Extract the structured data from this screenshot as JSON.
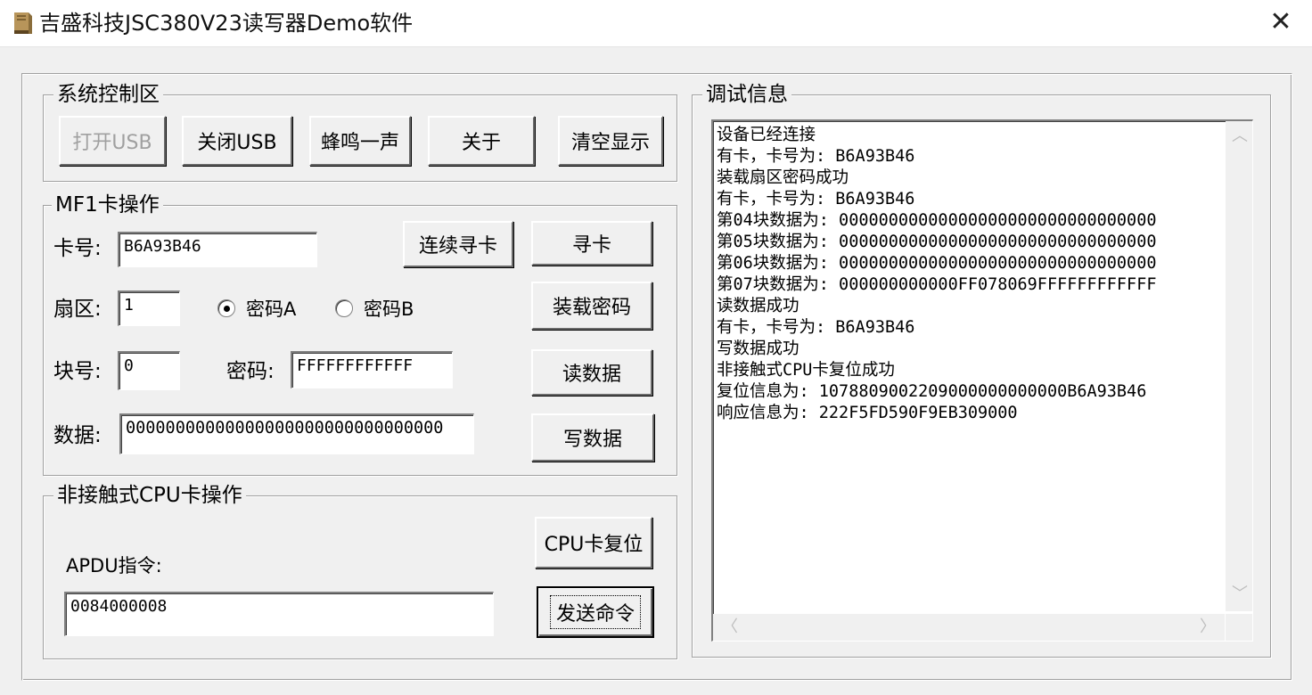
{
  "window": {
    "title": "吉盛科技JSC380V23读写器Demo软件",
    "close_glyph": "✕"
  },
  "system_group": {
    "title": "系统控制区",
    "open_usb": "打开USB",
    "close_usb": "关闭USB",
    "beep": "蜂鸣一声",
    "about": "关于",
    "clear": "清空显示"
  },
  "mf1_group": {
    "title": "MF1卡操作",
    "card_label": "卡号:",
    "card_value": "B6A93B46",
    "sector_label": "扇区:",
    "sector_value": "1",
    "key_a_label": "密码A",
    "key_b_label": "密码B",
    "selected_key": "A",
    "block_label": "块号:",
    "block_value": "0",
    "password_label": "密码:",
    "password_value": "FFFFFFFFFFFF",
    "data_label": "数据:",
    "data_value": "00000000000000000000000000000000",
    "continuous_search": "连续寻卡",
    "search": "寻卡",
    "load_key": "装载密码",
    "read_data": "读数据",
    "write_data": "写数据"
  },
  "cpu_group": {
    "title": "非接触式CPU卡操作",
    "apdu_label": "APDU指令:",
    "apdu_value": "0084000008",
    "reset": "CPU卡复位",
    "send": "发送命令"
  },
  "debug_group": {
    "title": "调试信息",
    "lines": [
      "设备已经连接",
      "有卡，卡号为: B6A93B46",
      "装载扇区密码成功",
      "有卡，卡号为: B6A93B46",
      "第04块数据为: 00000000000000000000000000000000",
      "第05块数据为: 00000000000000000000000000000000",
      "第06块数据为: 00000000000000000000000000000000",
      "第07块数据为: 000000000000FF078069FFFFFFFFFFFF",
      "读数据成功",
      "有卡，卡号为: B6A93B46",
      "写数据成功",
      "非接触式CPU卡复位成功",
      "复位信息为: 1078809002209000000000000B6A93B46",
      "响应信息为: 222F5FD590F9EB309000"
    ]
  },
  "icons": {
    "app": "book-icon",
    "scroll_up": "chevron-up-icon",
    "scroll_down": "chevron-down-icon",
    "scroll_left": "chevron-left-icon",
    "scroll_right": "chevron-right-icon"
  }
}
